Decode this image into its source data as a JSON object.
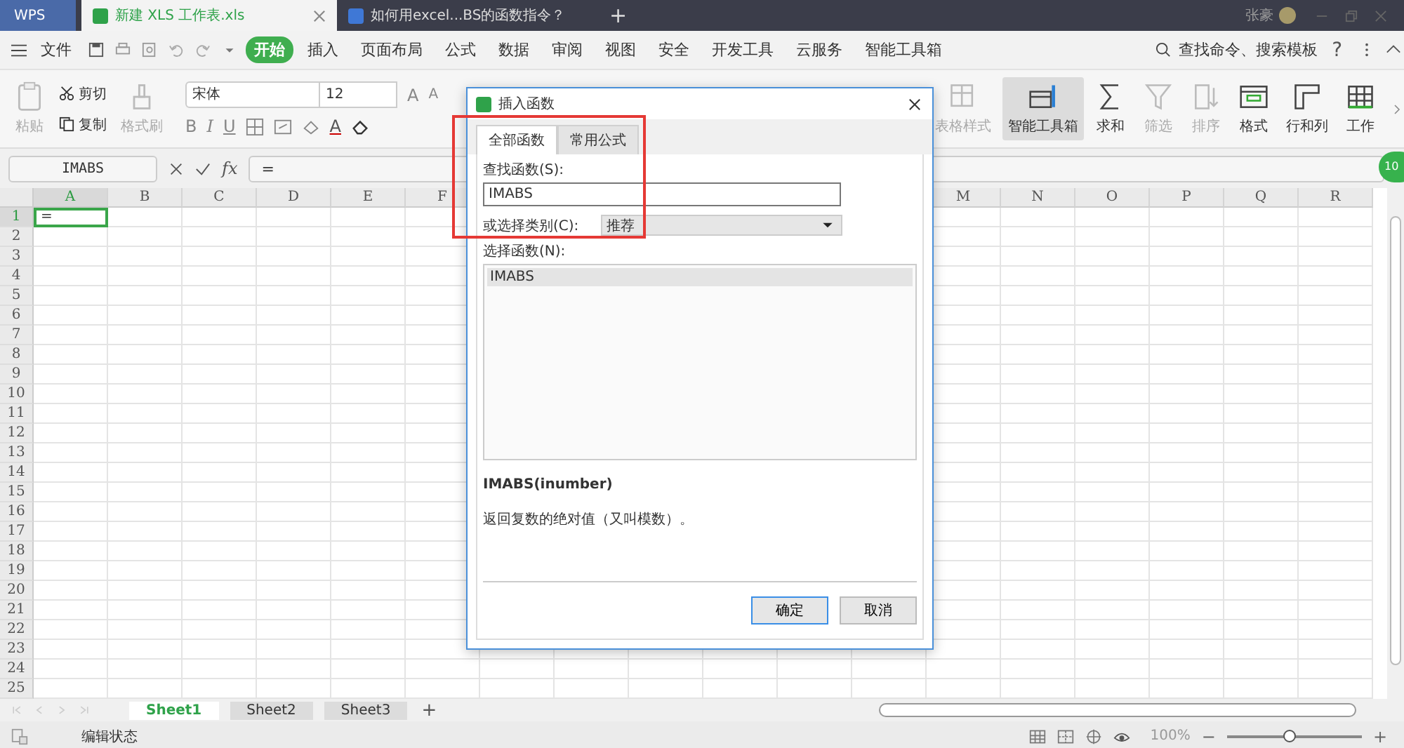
{
  "title_bar": {
    "app": "WPS",
    "tabs": [
      {
        "label": "新建 XLS 工作表.xls",
        "selected": true,
        "kind": "sheet"
      },
      {
        "label": "如何用excel...BS的函数指令？",
        "selected": false,
        "kind": "writer"
      }
    ],
    "new_tab": "+",
    "user": "张豪"
  },
  "menu": {
    "file": "文件",
    "tabs": [
      {
        "label": "开始",
        "selected": true
      },
      {
        "label": "插入",
        "selected": false
      },
      {
        "label": "页面布局",
        "selected": false
      },
      {
        "label": "公式",
        "selected": false
      },
      {
        "label": "数据",
        "selected": false
      },
      {
        "label": "审阅",
        "selected": false
      },
      {
        "label": "视图",
        "selected": false
      },
      {
        "label": "安全",
        "selected": false
      },
      {
        "label": "开发工具",
        "selected": false
      },
      {
        "label": "云服务",
        "selected": false
      },
      {
        "label": "智能工具箱",
        "selected": false
      }
    ],
    "search": "查找命令、搜索模板",
    "help": "?"
  },
  "ribbon": {
    "paste": "粘贴",
    "cut": "剪切",
    "copy": "复制",
    "painter": "格式刷",
    "font": "宋体",
    "size": "12",
    "size_buttons": [
      {
        "label": "A",
        "kind": "grow"
      },
      {
        "label": "A",
        "kind": "shrink"
      }
    ],
    "style_buttons": [
      {
        "label": "B",
        "kind": "bold"
      },
      {
        "label": "I",
        "kind": "italic"
      },
      {
        "label": "U",
        "kind": "underline"
      }
    ],
    "font_color": "A",
    "tools": [
      {
        "label": "表格样式",
        "kind": "table-style",
        "disabled": true,
        "on": false
      },
      {
        "label": "智能工具箱",
        "kind": "toolbox",
        "disabled": false,
        "on": true
      },
      {
        "label": "求和",
        "kind": "sum",
        "disabled": false,
        "on": false
      },
      {
        "label": "筛选",
        "kind": "filter",
        "disabled": true,
        "on": false
      },
      {
        "label": "排序",
        "kind": "sort",
        "disabled": true,
        "on": false
      },
      {
        "label": "格式",
        "kind": "format",
        "disabled": false,
        "on": false
      },
      {
        "label": "行和列",
        "kind": "rowcol",
        "disabled": false,
        "on": false
      },
      {
        "label": "工作",
        "kind": "sheet",
        "disabled": false,
        "on": false
      }
    ]
  },
  "formula_bar": {
    "name_box": "IMABS",
    "fx": "fx",
    "value": "="
  },
  "badge": "10",
  "grid": {
    "columns": [
      {
        "label": "A",
        "selected": true
      },
      {
        "label": "B",
        "selected": false
      },
      {
        "label": "C",
        "selected": false
      },
      {
        "label": "D",
        "selected": false
      },
      {
        "label": "E",
        "selected": false
      },
      {
        "label": "F",
        "selected": false
      },
      {
        "label": "M",
        "selected": false
      },
      {
        "label": "N",
        "selected": false
      },
      {
        "label": "O",
        "selected": false
      },
      {
        "label": "P",
        "selected": false
      },
      {
        "label": "Q",
        "selected": false
      },
      {
        "label": "R",
        "selected": false
      }
    ],
    "rows": [
      {
        "label": "1",
        "selected": true
      },
      {
        "label": "2",
        "selected": false
      },
      {
        "label": "3",
        "selected": false
      },
      {
        "label": "4",
        "selected": false
      },
      {
        "label": "5",
        "selected": false
      },
      {
        "label": "6",
        "selected": false
      },
      {
        "label": "7",
        "selected": false
      },
      {
        "label": "8",
        "selected": false
      },
      {
        "label": "9",
        "selected": false
      },
      {
        "label": "10",
        "selected": false
      },
      {
        "label": "11",
        "selected": false
      },
      {
        "label": "12",
        "selected": false
      },
      {
        "label": "13",
        "selected": false
      },
      {
        "label": "14",
        "selected": false
      },
      {
        "label": "15",
        "selected": false
      },
      {
        "label": "16",
        "selected": false
      },
      {
        "label": "17",
        "selected": false
      },
      {
        "label": "18",
        "selected": false
      },
      {
        "label": "19",
        "selected": false
      },
      {
        "label": "20",
        "selected": false
      },
      {
        "label": "21",
        "selected": false
      },
      {
        "label": "22",
        "selected": false
      },
      {
        "label": "23",
        "selected": false
      },
      {
        "label": "24",
        "selected": false
      },
      {
        "label": "25",
        "selected": false
      }
    ],
    "active_cell": "="
  },
  "sheets": {
    "tabs": [
      {
        "label": "Sheet1",
        "selected": true
      },
      {
        "label": "Sheet2",
        "selected": false
      },
      {
        "label": "Sheet3",
        "selected": false
      }
    ],
    "add": "+"
  },
  "status_bar": {
    "mode": "编辑状态",
    "zoom": "100%",
    "minus": "−",
    "plus": "+",
    "level": 0.47
  },
  "dialog": {
    "title": "插入函数",
    "tabs": [
      {
        "label": "全部函数",
        "selected": true
      },
      {
        "label": "常用公式",
        "selected": false
      }
    ],
    "search_label": "查找函数(S):",
    "search_value": "IMABS",
    "category_label": "或选择类别(C):",
    "category_value": "推荐",
    "list_label": "选择函数(N):",
    "functions": [
      {
        "label": "IMABS",
        "selected": true
      }
    ],
    "signature": "IMABS(inumber)",
    "description": "返回复数的绝对值（又叫模数）。",
    "buttons": [
      {
        "label": "确定",
        "kind": "primary"
      },
      {
        "label": "取消",
        "kind": "secondary"
      }
    ]
  }
}
